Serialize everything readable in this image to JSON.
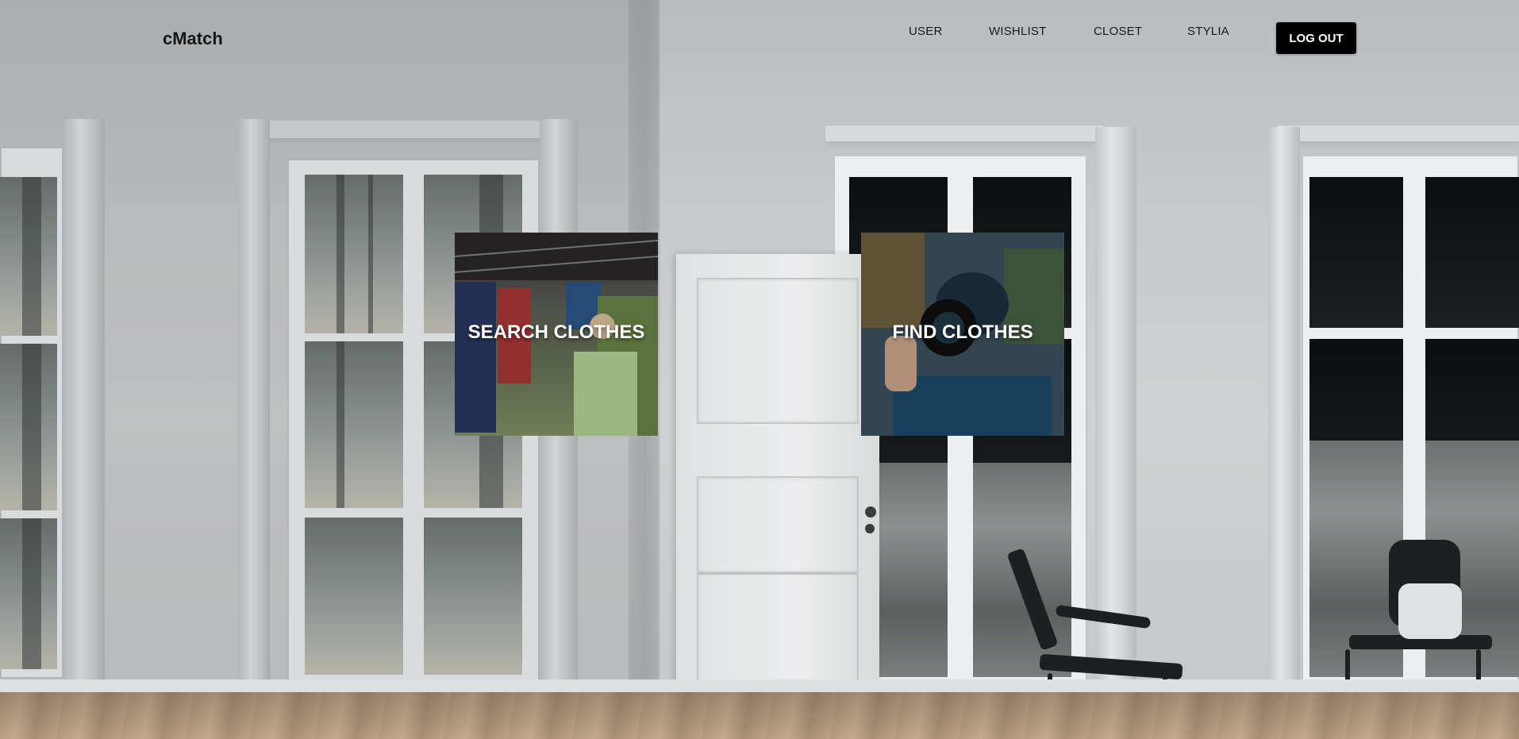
{
  "app": {
    "logo": "cMatch"
  },
  "nav": {
    "items": [
      {
        "label": "USER"
      },
      {
        "label": "WISHLIST"
      },
      {
        "label": "CLOSET"
      },
      {
        "label": "STYLIA"
      }
    ],
    "logout_label": "LOG OUT"
  },
  "tiles": {
    "search": {
      "label": "SEARCH CLOTHES"
    },
    "find": {
      "label": "FIND CLOTHES"
    }
  },
  "colors": {
    "logout_bg": "#000000",
    "tile_text": "#ffffff",
    "nav_text": "#1a1a1a"
  }
}
